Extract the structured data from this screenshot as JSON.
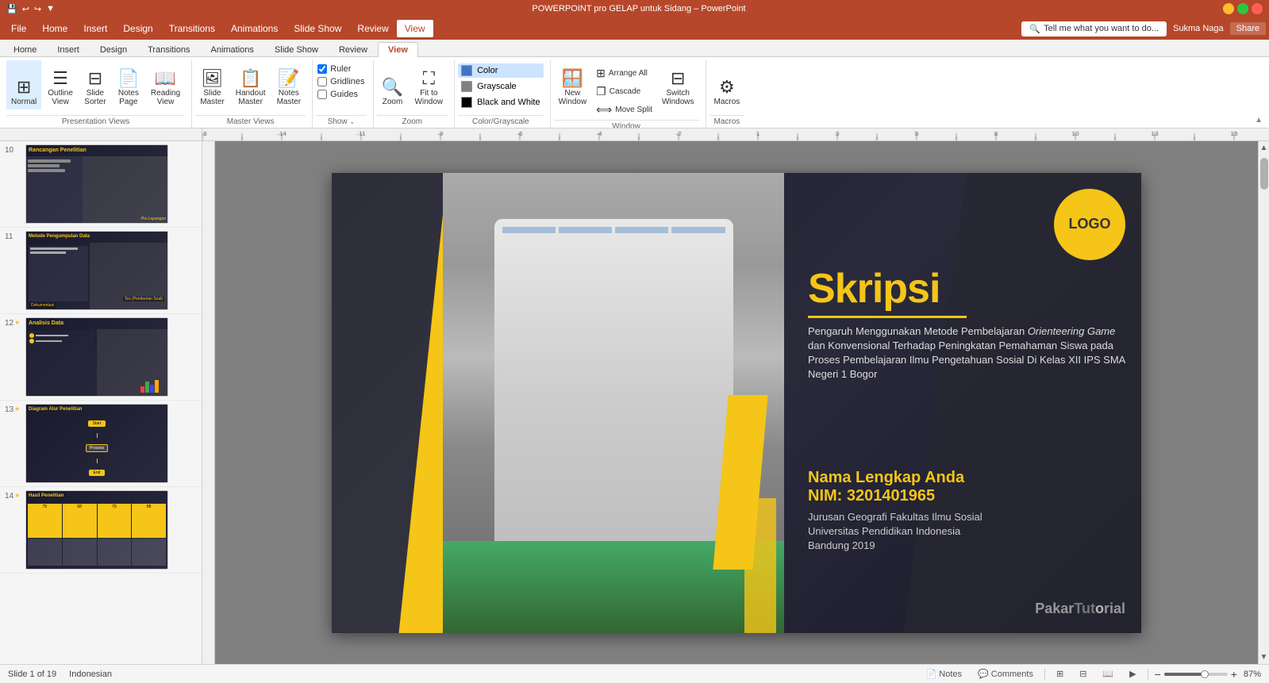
{
  "titlebar": {
    "title": "POWERPOINT pro GELAP untuk Sidang – PowerPoint",
    "quickaccess": [
      "save",
      "undo",
      "redo",
      "customqat"
    ]
  },
  "menu": {
    "items": [
      "File",
      "Home",
      "Insert",
      "Design",
      "Transitions",
      "Animations",
      "Slide Show",
      "Review",
      "View"
    ],
    "active": "View",
    "tellme": "Tell me what you want to do...",
    "user": "Sukma Naga",
    "share": "Share"
  },
  "ribbon": {
    "groups": [
      {
        "label": "Presentation Views",
        "buttons": [
          "Normal",
          "Outline View",
          "Slide Sorter",
          "Notes Page",
          "Reading View"
        ]
      },
      {
        "label": "Master Views",
        "buttons": [
          "Slide Master",
          "Handout Master",
          "Notes Master"
        ]
      },
      {
        "label": "Show",
        "checkboxes": [
          "Ruler",
          "Gridlines",
          "Guides"
        ]
      },
      {
        "label": "Zoom",
        "buttons": [
          "Zoom",
          "Fit to Window"
        ]
      },
      {
        "label": "Color/Grayscale",
        "options": [
          "Color",
          "Grayscale",
          "Black and White"
        ]
      },
      {
        "label": "Window",
        "buttons": [
          "New Window",
          "Arrange All",
          "Cascade",
          "Move Split",
          "Switch Windows"
        ]
      },
      {
        "label": "Macros",
        "buttons": [
          "Macros"
        ]
      }
    ]
  },
  "slides": [
    {
      "number": "10",
      "title": "Rancangan Penelitian",
      "star": false
    },
    {
      "number": "11",
      "title": "Metode Pengumpulan Data",
      "star": false
    },
    {
      "number": "12",
      "title": "Analisis Data",
      "star": true
    },
    {
      "number": "13",
      "title": "Diagram Alur Penelitian",
      "star": true
    },
    {
      "number": "14",
      "title": "Hasil Penelitian",
      "star": true
    }
  ],
  "slide_content": {
    "logo_text": "LOGO",
    "title_prefix": "S",
    "title_main": "kripsi",
    "subtitle": "Pengaruh Menggunakan Metode Pembelajaran Orienteering Game dan Konvensional Terhadap Peningkatan Pemahaman Siswa pada Proses Pembelajaran Ilmu Pengetahuan Sosial Di Kelas XII IPS SMA Negeri 1 Bogor",
    "name_label": "Nama Lengkap Anda",
    "nim_label": "NIM: 3201401965",
    "institution_line1": "Jurusan Geografi  Fakultas Ilmu Sosial",
    "institution_line2": "Universitas Pendidikan Indonesia",
    "institution_line3": "Bandung 2019",
    "watermark": "PakarTutorial"
  },
  "statusbar": {
    "slide_info": "Slide 1 of 19",
    "language": "Indonesian",
    "notes_label": "Notes",
    "comments_label": "Comments",
    "zoom_percent": "87%"
  }
}
